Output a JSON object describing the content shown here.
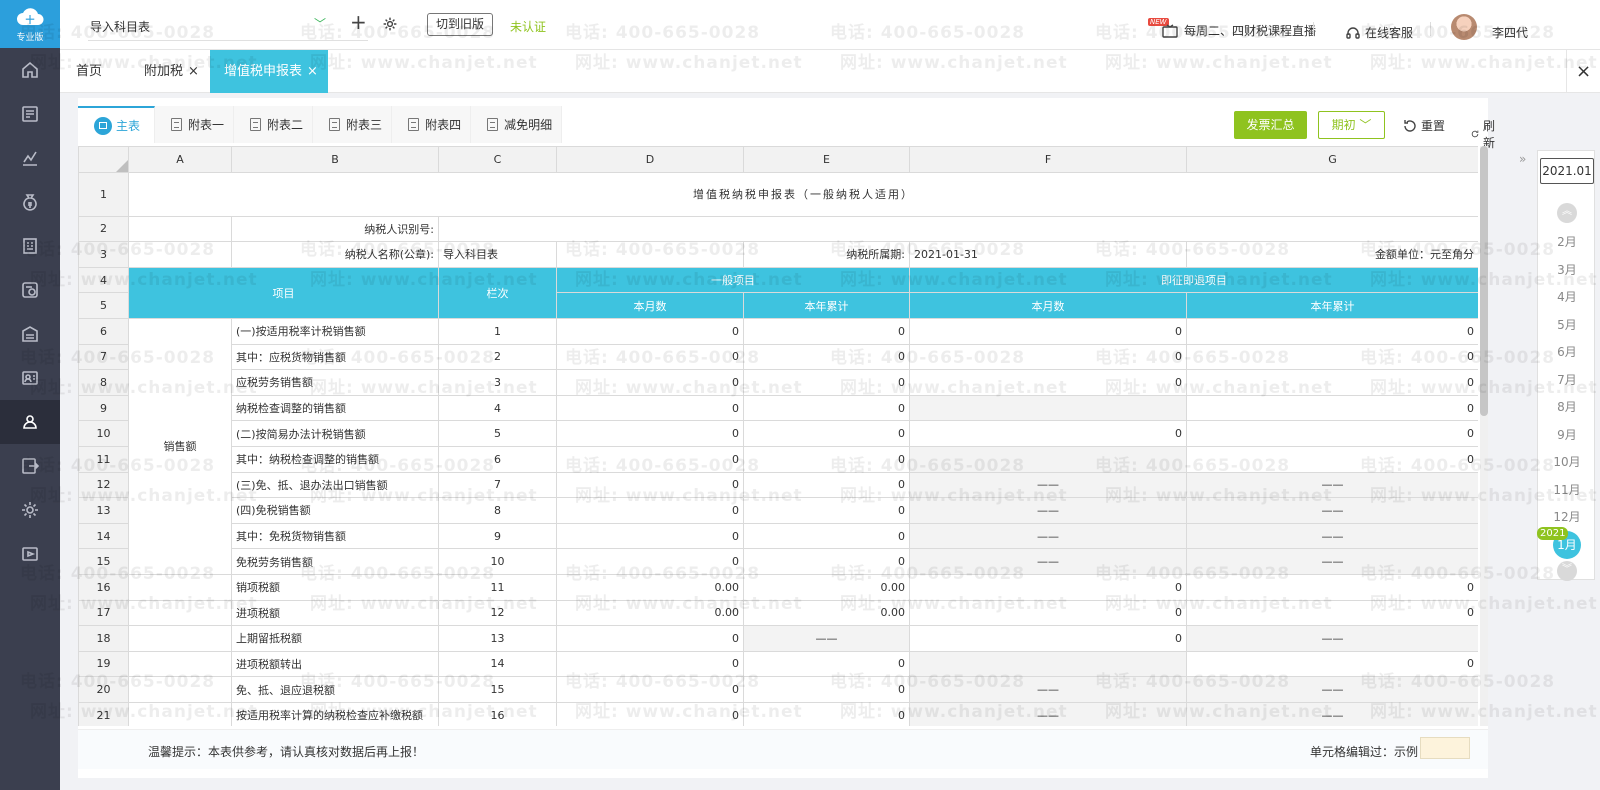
{
  "app": {
    "logo_label": "专业版",
    "company": "导入科目表",
    "switch_old_label": "切到旧版",
    "verify_status": "未认证"
  },
  "header": {
    "new_badge": "NEW",
    "live_label": "每周二、四财税课程直播",
    "service_label": "在线客服",
    "user_name": "李四代"
  },
  "tabs": [
    {
      "label": "首页"
    },
    {
      "label": "附加税",
      "close": "×"
    },
    {
      "label": "增值税申报表",
      "close": "×"
    }
  ],
  "close_all": "×",
  "sheet_tabs": [
    "主表",
    "附表一",
    "附表二",
    "附表三",
    "附表四",
    "减免明细"
  ],
  "toolbar": {
    "invoice_summary": "发票汇总",
    "period_select": "期初",
    "reset": "重置",
    "refresh": "刷新"
  },
  "columns": [
    "A",
    "B",
    "C",
    "D",
    "E",
    "F",
    "G"
  ],
  "report": {
    "title": "增值税纳税申报表（一般纳税人适用）",
    "taxpayer_id_label": "纳税人识别号:",
    "taxpayer_name_label": "纳税人名称(公章):",
    "taxpayer_name": "导入科目表",
    "period_label": "纳税所属期:",
    "period_value": "2021-01-31",
    "unit_label": "金额单位：元至角分",
    "header_item": "项目",
    "header_col": "栏次",
    "header_general": "一般项目",
    "header_refund": "即征即退项目",
    "header_month": "本月数",
    "header_year": "本年累计",
    "category_sales": "销售额"
  },
  "rows": [
    {
      "n": "6",
      "item": "(一)按适用税率计税销售额",
      "col": "1",
      "d": "0",
      "e": "0",
      "f": "0",
      "g": "0"
    },
    {
      "n": "7",
      "item": "其中：应税货物销售额",
      "col": "2",
      "d": "0",
      "e": "0",
      "f": "0",
      "g": "0"
    },
    {
      "n": "8",
      "item": "应税劳务销售额",
      "col": "3",
      "d": "0",
      "e": "0",
      "f": "0",
      "g": "0"
    },
    {
      "n": "9",
      "item": "纳税检查调整的销售额",
      "col": "4",
      "d": "0",
      "e": "0",
      "f": "",
      "g": "0"
    },
    {
      "n": "10",
      "item": "(二)按简易办法计税销售额",
      "col": "5",
      "d": "0",
      "e": "0",
      "f": "0",
      "g": "0"
    },
    {
      "n": "11",
      "item": "其中：纳税检查调整的销售额",
      "col": "6",
      "d": "0",
      "e": "0",
      "f": "",
      "g": "0"
    },
    {
      "n": "12",
      "item": "(三)免、抵、退办法出口销售额",
      "col": "7",
      "d": "0",
      "e": "0",
      "f": "——",
      "g": "——"
    },
    {
      "n": "13",
      "item": "(四)免税销售额",
      "col": "8",
      "d": "0",
      "e": "0",
      "f": "——",
      "g": "——"
    },
    {
      "n": "14",
      "item": "其中：免税货物销售额",
      "col": "9",
      "d": "0",
      "e": "0",
      "f": "——",
      "g": "——"
    },
    {
      "n": "15",
      "item": "免税劳务销售额",
      "col": "10",
      "d": "0",
      "e": "0",
      "f": "——",
      "g": "——"
    },
    {
      "n": "16",
      "item": "销项税额",
      "col": "11",
      "d": "0.00",
      "e": "0.00",
      "f": "0",
      "g": "0"
    },
    {
      "n": "17",
      "item": "进项税额",
      "col": "12",
      "d": "0.00",
      "e": "0.00",
      "f": "0",
      "g": "0"
    },
    {
      "n": "18",
      "item": "上期留抵税额",
      "col": "13",
      "d": "0",
      "e": "——",
      "f": "0",
      "g": "——"
    },
    {
      "n": "19",
      "item": "进项税额转出",
      "col": "14",
      "d": "0",
      "e": "0",
      "f": "",
      "g": "0"
    },
    {
      "n": "20",
      "item": "免、抵、退应退税额",
      "col": "15",
      "d": "0",
      "e": "0",
      "f": "——",
      "g": "——"
    },
    {
      "n": "21",
      "item": "按适用税率计算的纳税检查应补缴税额",
      "col": "16",
      "d": "0",
      "e": "0",
      "f": "——",
      "g": "——"
    }
  ],
  "footer": {
    "tip": "温馨提示：本表供参考，请认真核对数据后再上报！",
    "legend_label": "单元格编辑过：示例"
  },
  "periods": {
    "expand": "»",
    "current": "2021.01",
    "months": [
      "2月",
      "3月",
      "4月",
      "5月",
      "6月",
      "7月",
      "8月",
      "9月",
      "10月",
      "11月",
      "12月"
    ],
    "active_month": "1月",
    "active_year": "2021",
    "up": "︽",
    "down": "︾"
  },
  "watermark": {
    "phone": "电话: 400-665-0028",
    "site": "网址: www.chanjet.net"
  },
  "colors": {
    "accent": "#3ec3df",
    "green": "#8fc31f",
    "nav_bg": "#3b3f4f"
  }
}
